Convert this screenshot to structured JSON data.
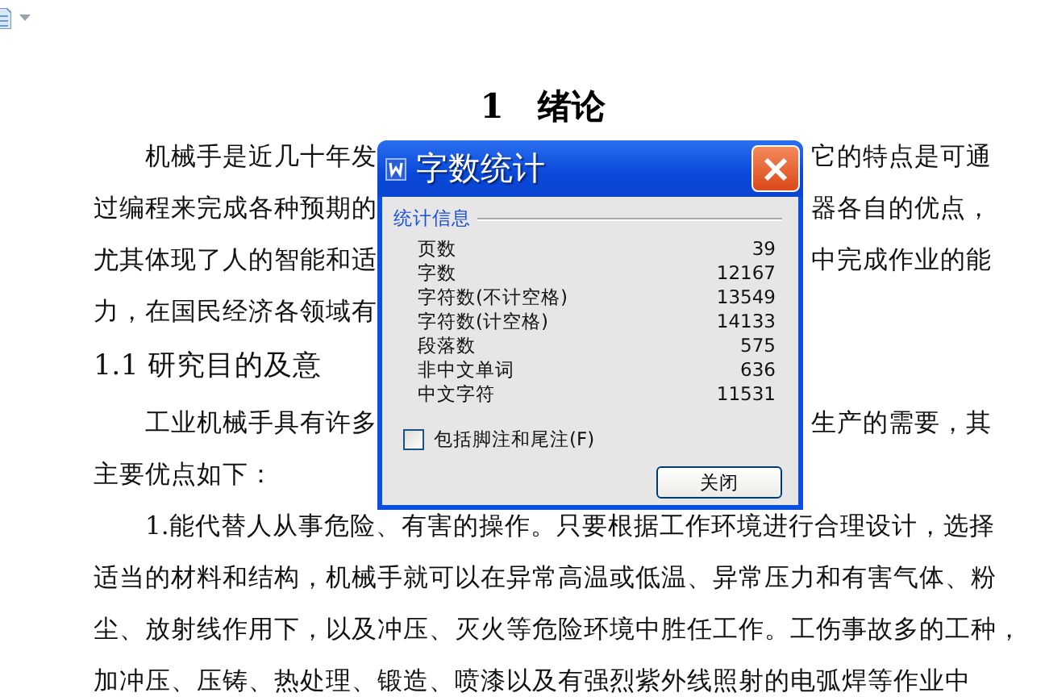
{
  "document": {
    "heading": "1　绪论",
    "lines": [
      {
        "kind": "first",
        "left": "机械手是近几十年发",
        "right": "它的特点是可通"
      },
      {
        "kind": "body",
        "left": "过编程来完成各种预期的",
        "right": "器各自的优点，"
      },
      {
        "kind": "body",
        "left": "尤其体现了人的智能和适",
        "right": "中完成作业的能"
      },
      {
        "kind": "body",
        "left": "力，在国民经济各领域有"
      },
      {
        "kind": "section",
        "left": "1.1  研究目的及意"
      },
      {
        "kind": "first",
        "left": "工业机械手具有许多",
        "right": "生产的需要，其"
      },
      {
        "kind": "body",
        "left": "主要优点如下："
      },
      {
        "kind": "first",
        "left": "1.能代替人从事危险、有害的操作。只要根据工作环境进行合理设计，选择"
      },
      {
        "kind": "body",
        "left": "适当的材料和结构，机械手就可以在异常高温或低温、异常压力和有害气体、粉"
      },
      {
        "kind": "body",
        "left": "尘、放射线作用下，以及冲压、灭火等危险环境中胜任工作。工伤事故多的工种，"
      },
      {
        "kind": "body",
        "left": "加冲压、压铸、热处理、锻造、喷漆以及有强烈紫外线照射的电弧焊等作业中"
      }
    ]
  },
  "dialog": {
    "title": "字数统计",
    "group_label": "统计信息",
    "stats": [
      {
        "label": "页数",
        "value": "39"
      },
      {
        "label": "字数",
        "value": "12167"
      },
      {
        "label": "字符数(不计空格)",
        "value": "13549"
      },
      {
        "label": "字符数(计空格)",
        "value": "14133"
      },
      {
        "label": "段落数",
        "value": "575"
      },
      {
        "label": "非中文单词",
        "value": "636"
      },
      {
        "label": "中文字符",
        "value": "11531"
      }
    ],
    "checkbox": {
      "label": "包括脚注和尾注(F)",
      "checked": false
    },
    "button": "关闭"
  }
}
